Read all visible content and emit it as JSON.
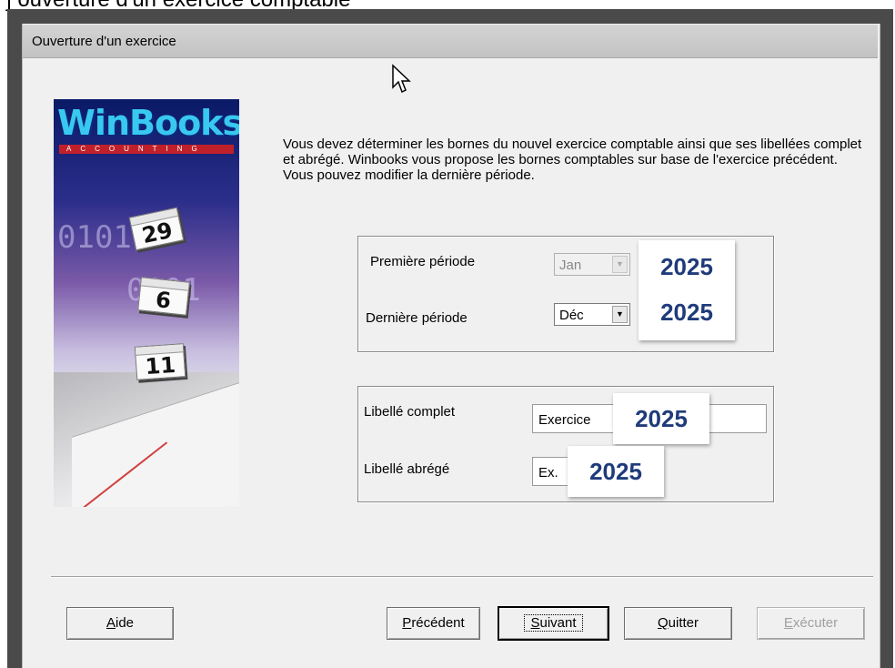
{
  "window": {
    "top_caption_fragment": "] ouverture d'un exercice comptable",
    "title": "Ouverture d'un exercice"
  },
  "banner": {
    "logo_text": "WinBooks",
    "logo_subtitle": "ACCOUNTING",
    "digits_row1": "01011",
    "digits_row2": "0101",
    "cal1_day": "29",
    "cal2_day": "6",
    "cal3_day": "11"
  },
  "instructions": "Vous devez déterminer les bornes du nouvel exercice comptable ainsi que ses libellées complet et abrégé. Winbooks vous propose les bornes comptables sur base de l'exercice précédent. Vous pouvez modifier la dernière période.",
  "periods": {
    "first_label": "Première période",
    "first_month": "Jan",
    "first_year": "2025",
    "last_label": "Dernière période",
    "last_month": "Déc",
    "last_year": "2025"
  },
  "labels": {
    "full_label": "Libellé complet",
    "full_value": "Exercice",
    "full_year": "2025",
    "short_label": "Libellé abrégé",
    "short_value": "Ex.",
    "short_year": "2025"
  },
  "buttons": {
    "help": "Aide",
    "help_key": "A",
    "previous": "Précédent",
    "previous_key": "P",
    "next": "Suivant",
    "next_key": "S",
    "quit": "Quitter",
    "quit_key": "Q",
    "execute": "Exécuter",
    "execute_key": "E"
  },
  "colors": {
    "overlay_text": "#1f3b7a",
    "dialog_bg": "#f0f0f0"
  }
}
